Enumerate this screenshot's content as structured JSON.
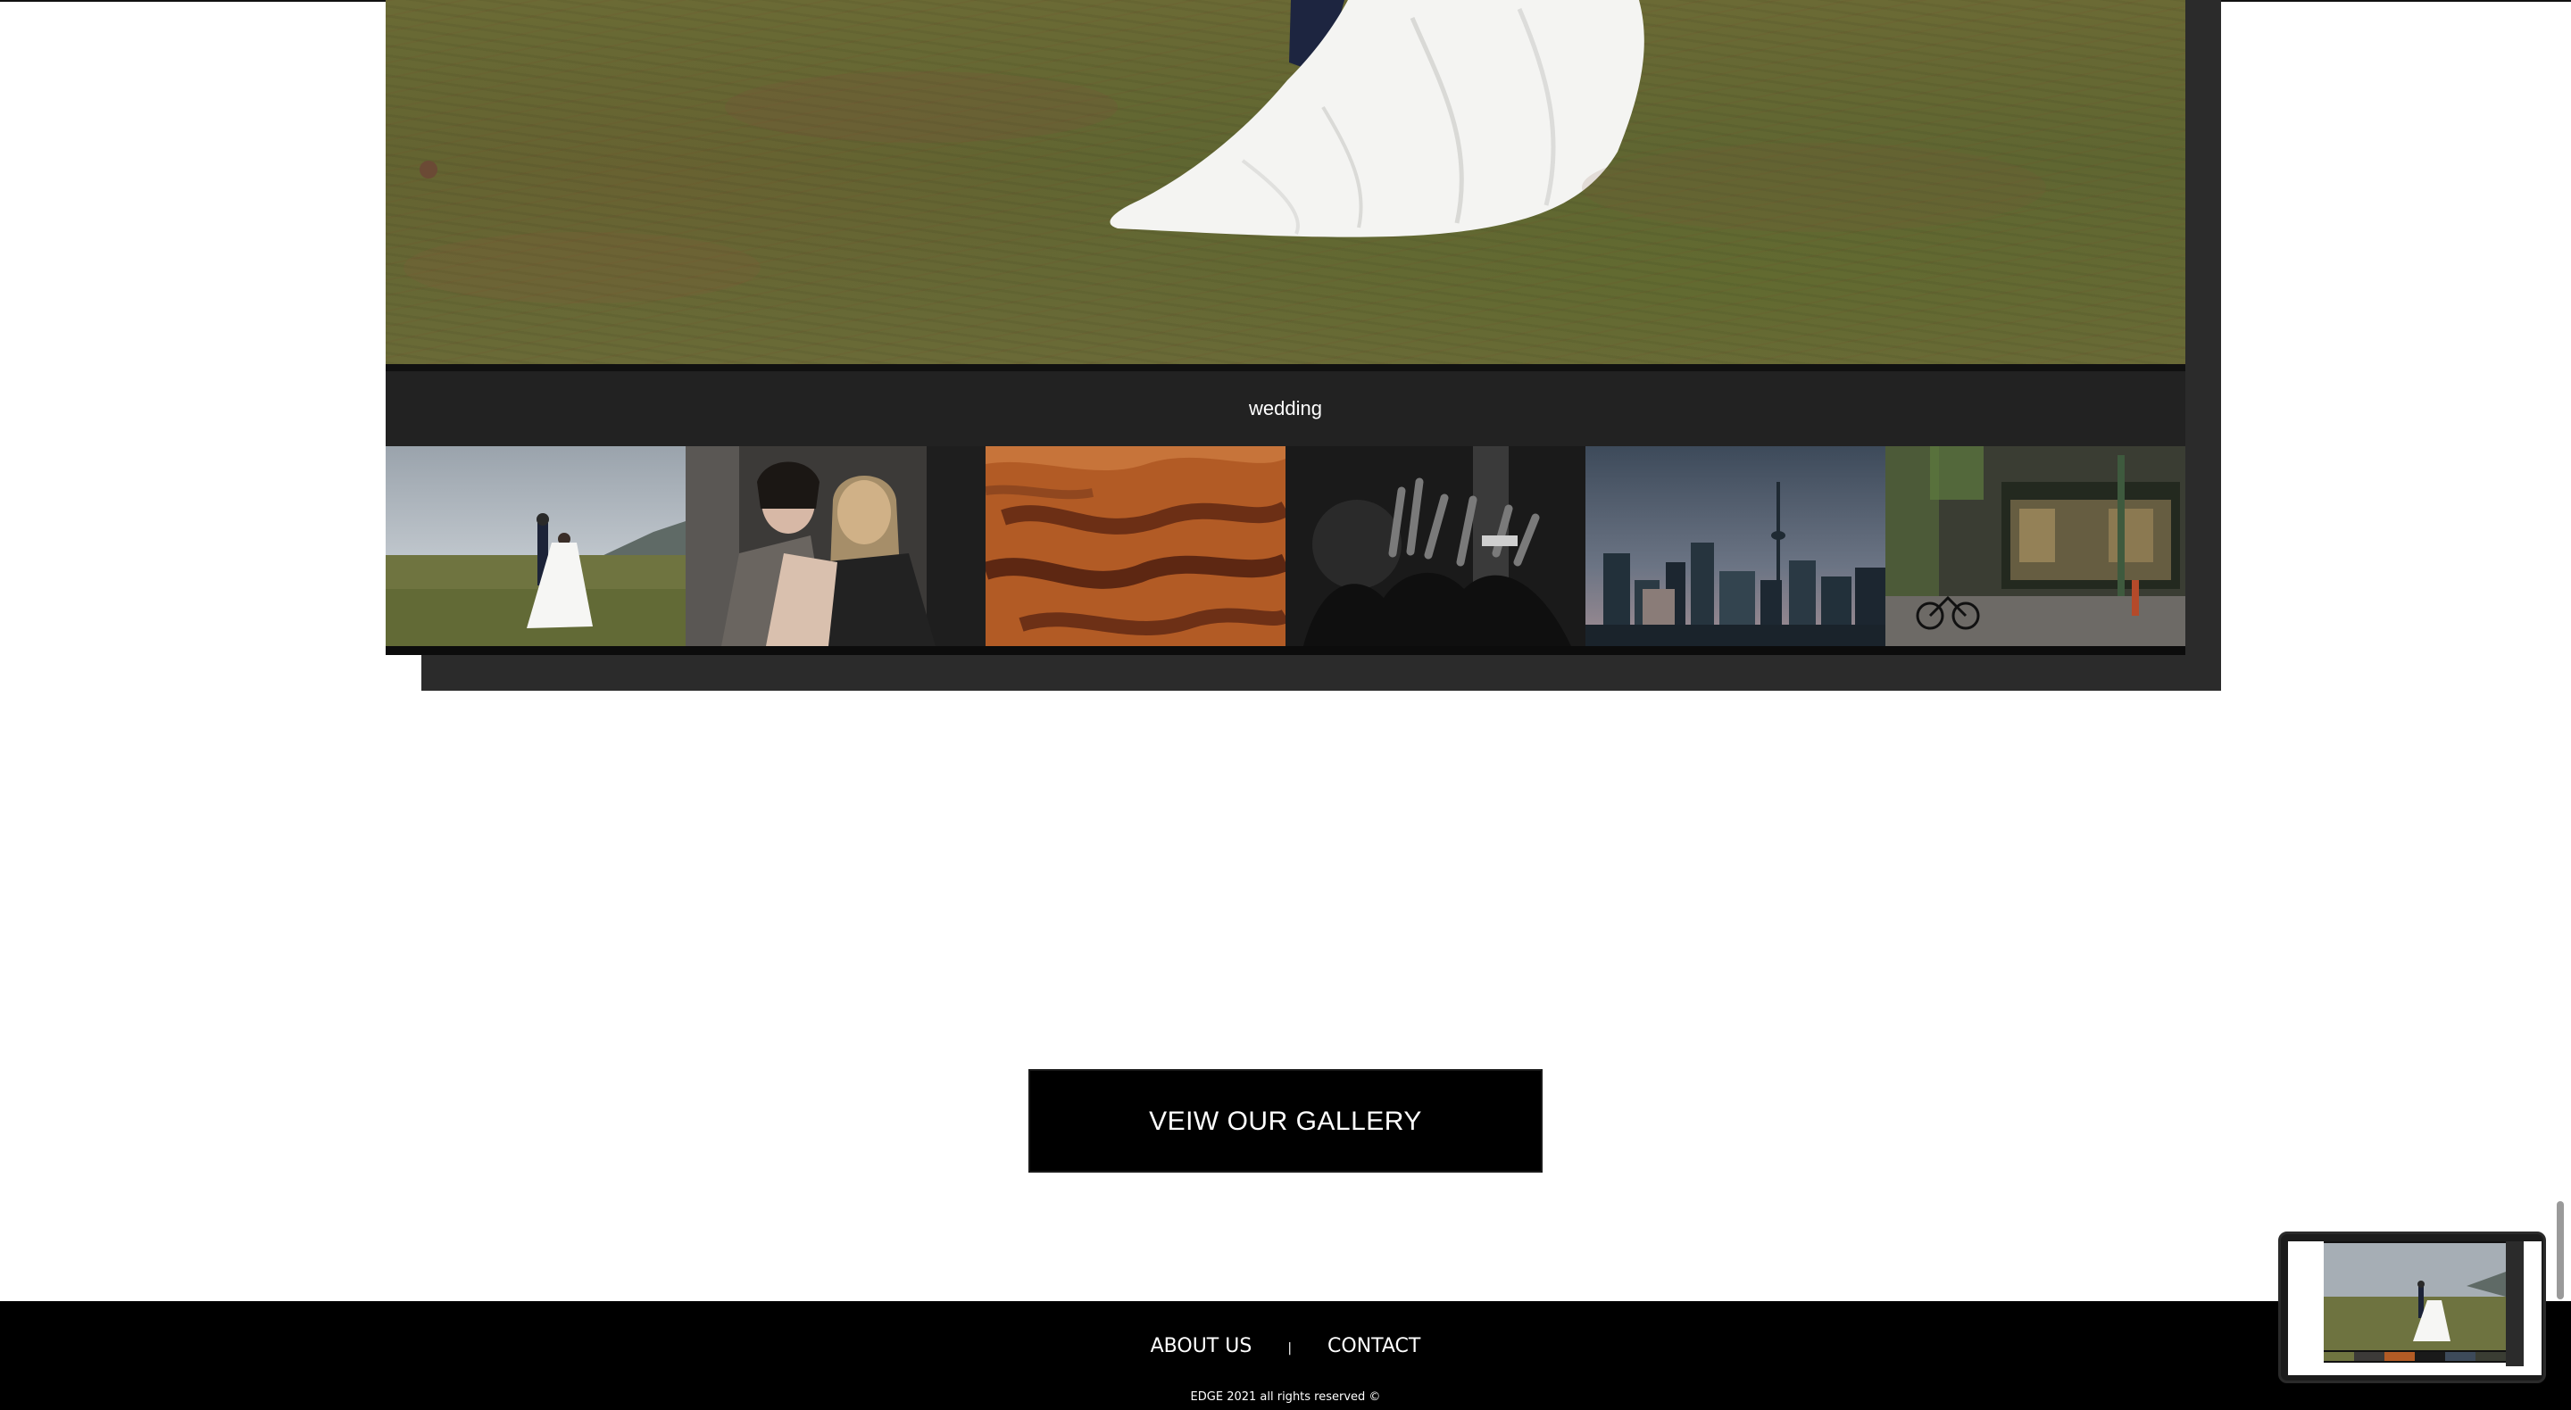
{
  "gallery": {
    "caption": "wedding",
    "thumbnails": [
      {
        "subject": "wedding couple in field"
      },
      {
        "subject": "two women portrait"
      },
      {
        "subject": "desert sand dunes"
      },
      {
        "subject": "concert crowd black and white"
      },
      {
        "subject": "city skyline at dusk"
      },
      {
        "subject": "bakery storefront"
      }
    ]
  },
  "cta": {
    "label": "VEIW OUR GALLERY"
  },
  "footer": {
    "links": [
      "ABOUT US",
      "CONTACT"
    ],
    "separator": "|",
    "copyright": "EDGE 2021 all rights reserved ©"
  },
  "colors": {
    "page_bg": "#ffffff",
    "card_shadow": "#2b2b2b",
    "caption_bar": "#222222",
    "cta_bg": "#000000",
    "footer_bg": "#000000"
  }
}
